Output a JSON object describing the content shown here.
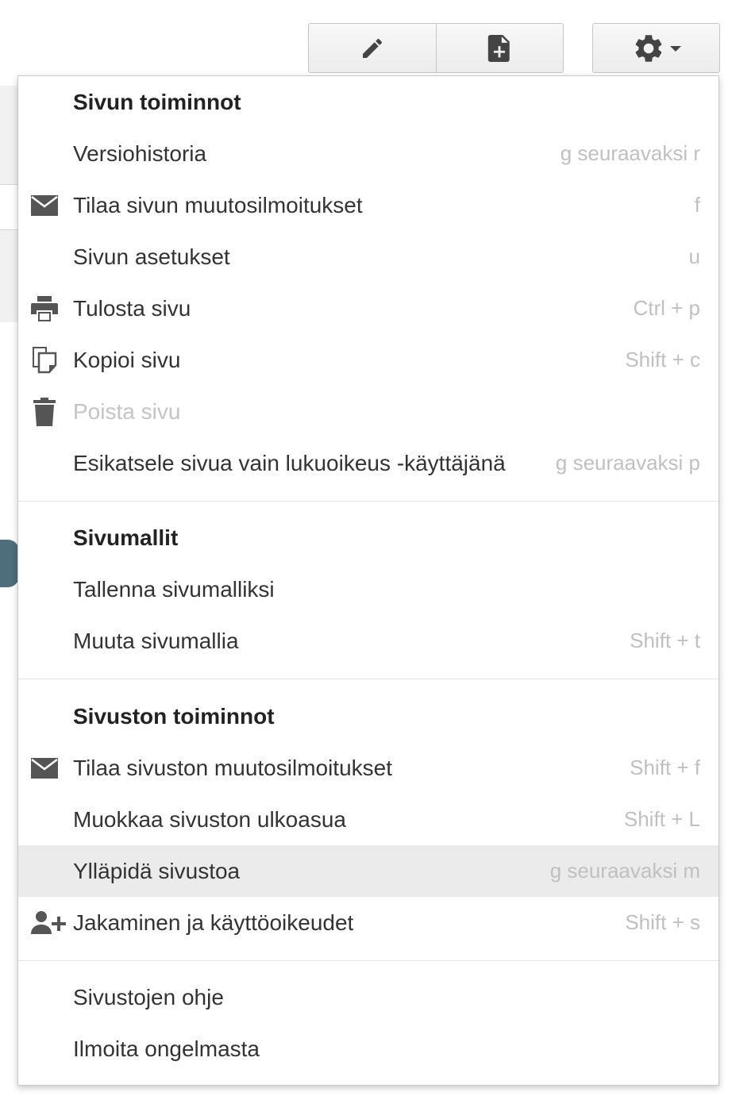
{
  "toolbar": {
    "edit_icon": "pencil-icon",
    "new_page_icon": "new-page-icon",
    "more_icon": "gear-icon"
  },
  "menu": {
    "page_actions": {
      "title": "Sivun toiminnot",
      "items": [
        {
          "label": "Versiohistoria",
          "shortcut": "g seuraavaksi r",
          "icon": ""
        },
        {
          "label": "Tilaa sivun muutosilmoitukset",
          "shortcut": "f",
          "icon": "envelope-icon"
        },
        {
          "label": "Sivun asetukset",
          "shortcut": "u",
          "icon": ""
        },
        {
          "label": "Tulosta sivu",
          "shortcut": "Ctrl + p",
          "icon": "printer-icon"
        },
        {
          "label": "Kopioi sivu",
          "shortcut": "Shift + c",
          "icon": "copy-icon"
        },
        {
          "label": "Poista sivu",
          "shortcut": "",
          "icon": "trash-icon",
          "disabled": true
        },
        {
          "label": "Esikatsele sivua vain lukuoikeus -käyttäjänä",
          "shortcut": "g seuraavaksi p",
          "icon": ""
        }
      ]
    },
    "templates": {
      "title": "Sivumallit",
      "items": [
        {
          "label": "Tallenna sivumalliksi",
          "shortcut": ""
        },
        {
          "label": "Muuta sivumallia",
          "shortcut": "Shift + t"
        }
      ]
    },
    "site_actions": {
      "title": "Sivuston toiminnot",
      "items": [
        {
          "label": "Tilaa sivuston muutosilmoitukset",
          "shortcut": "Shift + f",
          "icon": "envelope-icon"
        },
        {
          "label": "Muokkaa sivuston ulkoasua",
          "shortcut": "Shift + L",
          "icon": ""
        },
        {
          "label": "Ylläpidä sivustoa",
          "shortcut": "g seuraavaksi m",
          "icon": "",
          "highlighted": true
        },
        {
          "label": "Jakaminen ja käyttöoikeudet",
          "shortcut": "Shift + s",
          "icon": "add-person-icon"
        }
      ]
    },
    "help": {
      "items": [
        {
          "label": "Sivustojen ohje"
        },
        {
          "label": "Ilmoita ongelmasta"
        }
      ]
    }
  },
  "colors": {
    "text": "#333333",
    "muted": "#c0c0c0",
    "highlight": "#ebebeb",
    "icon": "#555555"
  }
}
